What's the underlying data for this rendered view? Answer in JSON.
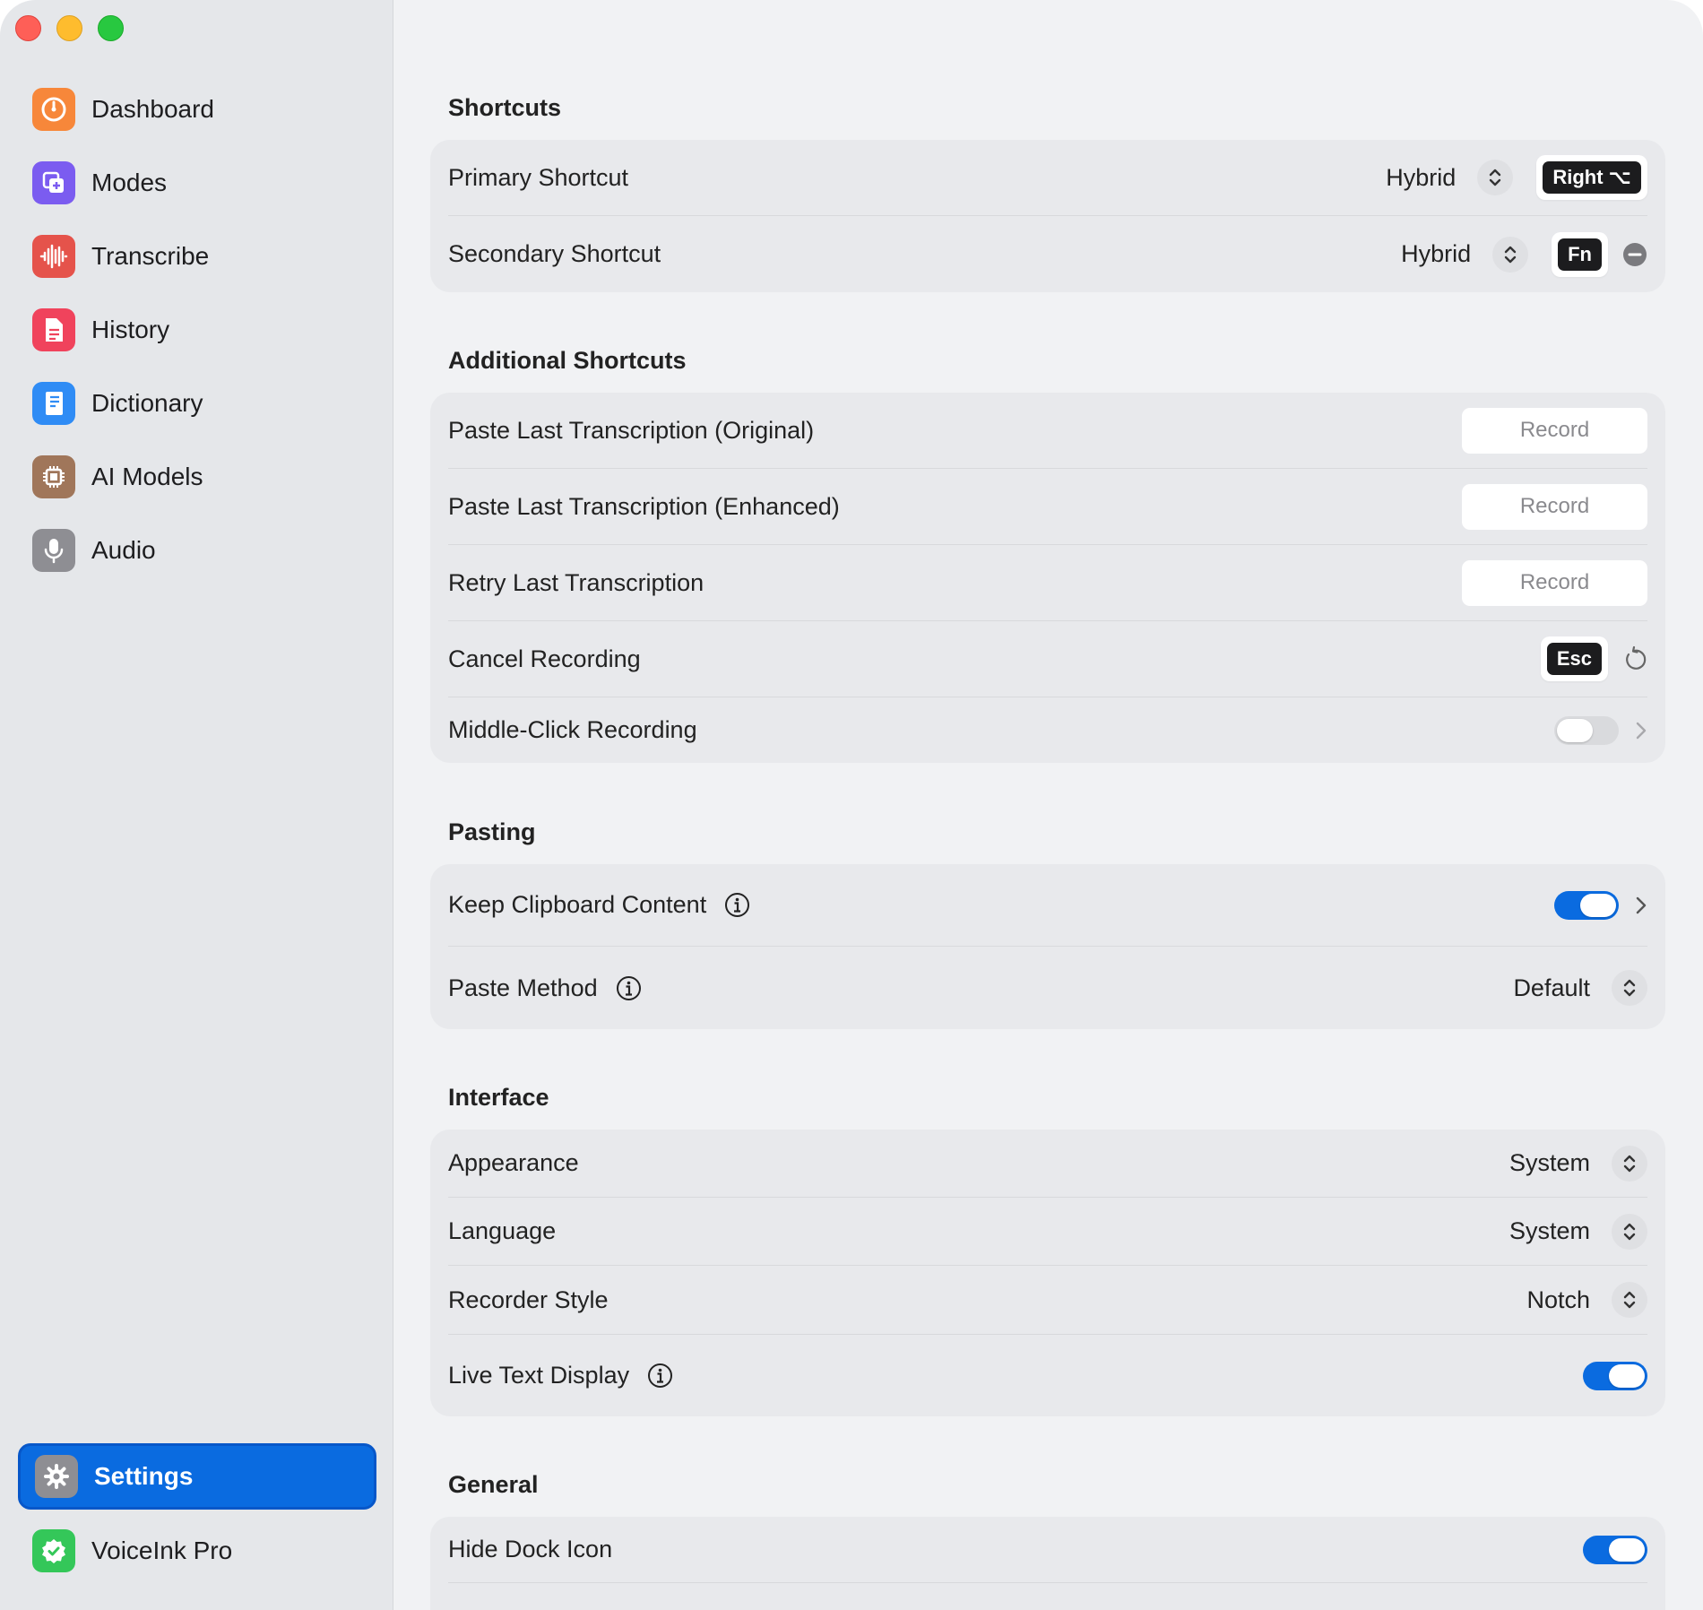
{
  "colors": {
    "accent": "#0a6be0",
    "window_bg": "#f1f2f4",
    "sidebar_bg": "#e5e7ea",
    "card_bg": "#e8e9ec"
  },
  "sidebar": {
    "items": [
      {
        "label": "Dashboard",
        "icon": "gauge-icon",
        "color": "#f7873a"
      },
      {
        "label": "Modes",
        "icon": "modes-icon",
        "color": "#7b5cf0"
      },
      {
        "label": "Transcribe",
        "icon": "waveform-icon",
        "color": "#e5534b"
      },
      {
        "label": "History",
        "icon": "document-icon",
        "color": "#f0435c"
      },
      {
        "label": "Dictionary",
        "icon": "book-icon",
        "color": "#2f8cf5"
      },
      {
        "label": "AI Models",
        "icon": "cpu-icon",
        "color": "#a0765a"
      },
      {
        "label": "Audio",
        "icon": "microphone-icon",
        "color": "#8e8e93"
      }
    ],
    "bottom": [
      {
        "label": "Settings",
        "icon": "gear-icon",
        "color": "#8e8e93",
        "active": true
      },
      {
        "label": "VoiceInk Pro",
        "icon": "verified-badge-icon",
        "color": "#34c759"
      }
    ]
  },
  "sections": {
    "shortcuts": {
      "title": "Shortcuts",
      "primary": {
        "label": "Primary Shortcut",
        "mode": "Hybrid",
        "key": "Right ⌥"
      },
      "secondary": {
        "label": "Secondary Shortcut",
        "mode": "Hybrid",
        "key": "Fn"
      }
    },
    "additional": {
      "title": "Additional Shortcuts",
      "paste_original": {
        "label": "Paste Last Transcription (Original)",
        "button": "Record"
      },
      "paste_enhanced": {
        "label": "Paste Last Transcription (Enhanced)",
        "button": "Record"
      },
      "retry": {
        "label": "Retry Last Transcription",
        "button": "Record"
      },
      "cancel": {
        "label": "Cancel Recording",
        "key": "Esc"
      },
      "middle_click": {
        "label": "Middle-Click Recording",
        "enabled": false
      }
    },
    "pasting": {
      "title": "Pasting",
      "keep_clipboard": {
        "label": "Keep Clipboard Content",
        "enabled": true
      },
      "paste_method": {
        "label": "Paste Method",
        "value": "Default"
      }
    },
    "interface": {
      "title": "Interface",
      "appearance": {
        "label": "Appearance",
        "value": "System"
      },
      "language": {
        "label": "Language",
        "value": "System"
      },
      "recorder_style": {
        "label": "Recorder Style",
        "value": "Notch"
      },
      "live_text": {
        "label": "Live Text Display",
        "enabled": true
      }
    },
    "general": {
      "title": "General",
      "hide_dock": {
        "label": "Hide Dock Icon",
        "enabled": true
      }
    }
  }
}
